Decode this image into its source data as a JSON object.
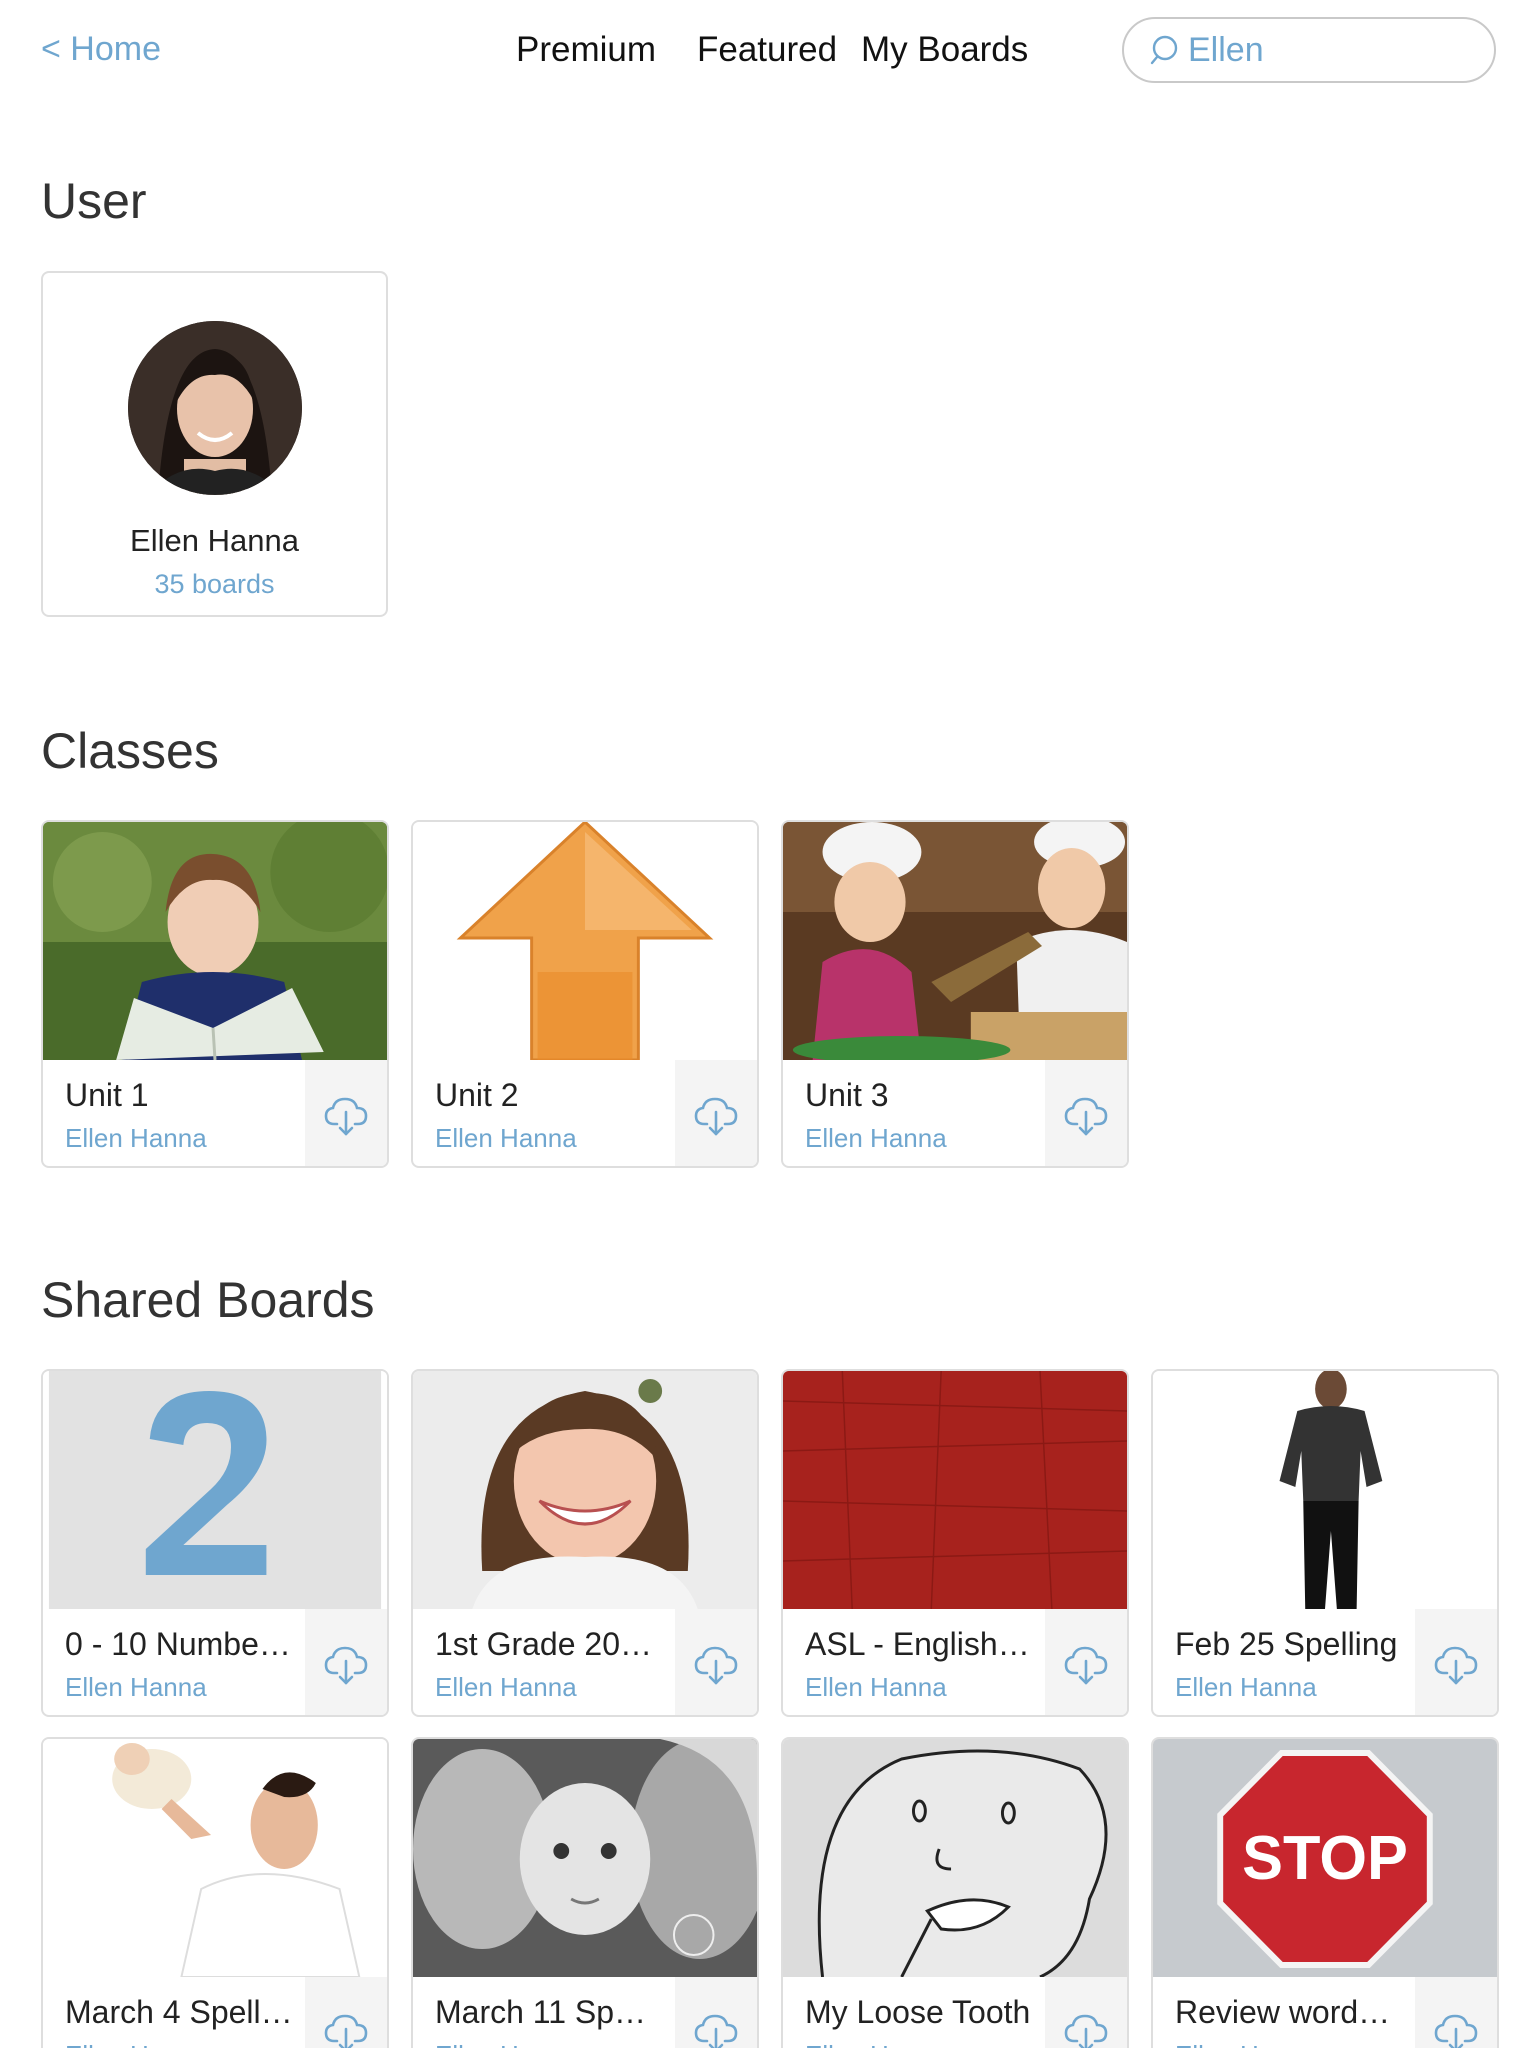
{
  "header": {
    "home_label": "< Home",
    "tabs": [
      "Premium",
      "Featured",
      "My Boards"
    ],
    "search_value": "Ellen"
  },
  "user_section": {
    "title": "User",
    "user": {
      "name": "Ellen Hanna",
      "boards": "35 boards"
    }
  },
  "classes_section": {
    "title": "Classes",
    "items": [
      {
        "title": "Unit 1",
        "author": "Ellen Hanna",
        "thumb": "girl-reading"
      },
      {
        "title": "Unit 2",
        "author": "Ellen Hanna",
        "thumb": "orange-up-arrow"
      },
      {
        "title": "Unit 3",
        "author": "Ellen Hanna",
        "thumb": "kids-cooking"
      }
    ]
  },
  "shared_section": {
    "title": "Shared Boards",
    "items": [
      {
        "title": "0 - 10 Numbe…",
        "author": "Ellen Hanna",
        "thumb": "number-two"
      },
      {
        "title": "1st Grade 20…",
        "author": "Ellen Hanna",
        "thumb": "smiling-girl"
      },
      {
        "title": "ASL - English…",
        "author": "Ellen Hanna",
        "thumb": "red-texture"
      },
      {
        "title": "Feb 25 Spelling",
        "author": "Ellen Hanna",
        "thumb": "standing-man"
      },
      {
        "title": "March 4 Spell…",
        "author": "Ellen Hanna",
        "thumb": "father-baby"
      },
      {
        "title": "March 11 Sp…",
        "author": "Ellen Hanna",
        "thumb": "family-kiss"
      },
      {
        "title": "My Loose Tooth",
        "author": "Ellen Hanna",
        "thumb": "loose-tooth-drawing"
      },
      {
        "title": "Review word…",
        "author": "Ellen Hanna",
        "thumb": "stop-sign"
      }
    ]
  },
  "colors": {
    "accent": "#6fa6cf",
    "border": "#dedede",
    "text": "#222222"
  },
  "icons": {
    "search": "search-icon",
    "download": "cloud-download-icon"
  }
}
